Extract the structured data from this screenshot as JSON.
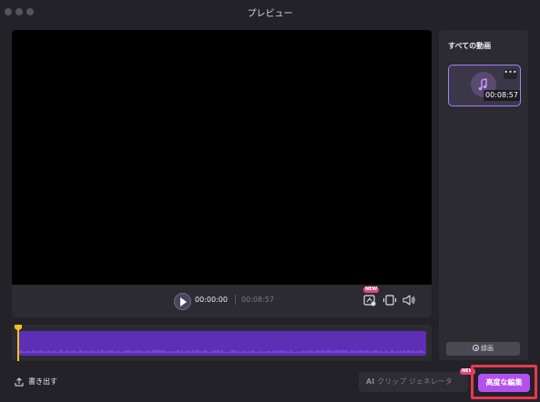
{
  "window": {
    "title": "プレビュー"
  },
  "player": {
    "current_time": "00:00:00",
    "total_time": "00:08:57",
    "new_badge": "NEW",
    "icons": [
      "play-icon",
      "ai-edit-icon",
      "crop-icon",
      "volume-icon"
    ]
  },
  "timeline": {
    "waveform_color": "#8b5cf6",
    "playhead_color": "#f2c11a"
  },
  "sidebar": {
    "title": "すべての動画",
    "items": [
      {
        "duration": "00:08:57",
        "more": "•••",
        "icon": "music-note-icon"
      }
    ],
    "record_label": "録画"
  },
  "footer": {
    "export_label": "書き出す",
    "ai_clip_prefix": "AI",
    "ai_clip_label": "クリップ ジェネレータ",
    "ai_new_badge": "NEW",
    "advanced_edit_label": "高度な編集"
  },
  "colors": {
    "accent": "#b450f0",
    "highlight": "#e8384f",
    "selection": "#a77cff"
  }
}
